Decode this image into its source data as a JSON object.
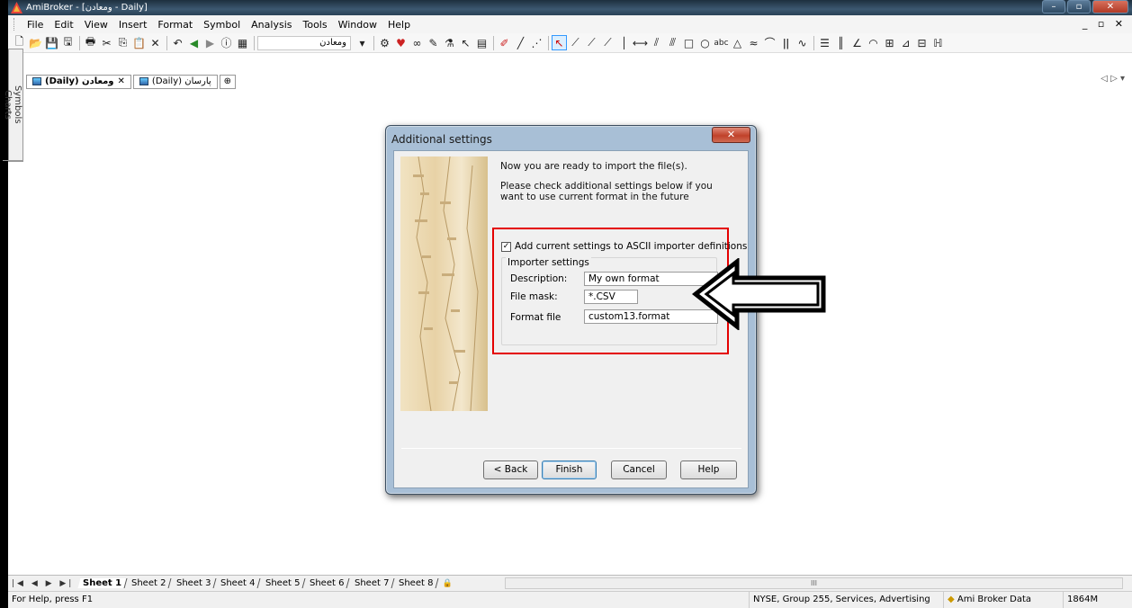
{
  "window": {
    "title": "AmiBroker - [ومعادن - Daily]",
    "minimize": "–",
    "restore": "▫",
    "close": "✕"
  },
  "menu": {
    "items": [
      "File",
      "Edit",
      "View",
      "Insert",
      "Format",
      "Symbol",
      "Analysis",
      "Tools",
      "Window",
      "Help"
    ],
    "mdi_controls": "_ ▫ ✕"
  },
  "toolbar": {
    "symbol_combo": "ومعادن"
  },
  "side_tabs": [
    "Symbols",
    "Charts"
  ],
  "doc_tabs": [
    {
      "label": "(Daily) ومعادن",
      "close": "✕",
      "active": true
    },
    {
      "label": "(Daily) پارسان",
      "active": false
    }
  ],
  "tab_nav": "◁ ▷ ▾",
  "dialog": {
    "title": "Additional settings",
    "close": "✕",
    "intro": "Now you are ready to import the file(s).",
    "hint": "Please check additional settings below if you want to use current format in the future",
    "checkbox_label": "Add current settings to ASCII importer definitions",
    "checkbox_checked": true,
    "group_label": "Importer settings",
    "description_label": "Description:",
    "description_value": "My own format",
    "filemask_label": "File mask:",
    "filemask_value": "*.CSV",
    "formatfile_label": "Format file",
    "formatfile_value": "custom13.format",
    "buttons": {
      "back": "< Back",
      "finish": "Finish",
      "cancel": "Cancel",
      "help": "Help"
    }
  },
  "sheets": [
    "Sheet 1",
    "Sheet 2",
    "Sheet 3",
    "Sheet 4",
    "Sheet 5",
    "Sheet 6",
    "Sheet 7",
    "Sheet 8"
  ],
  "sheet_active": "Sheet 1",
  "sheet_nav": "|◀ ◀ ▶ ▶|",
  "scroll_mark": "III",
  "status": {
    "help": "For Help, press F1",
    "symbol_info": "NYSE, Group 255, Services, Advertising",
    "data_source": "Ami Broker Data",
    "memory": "1864M"
  }
}
